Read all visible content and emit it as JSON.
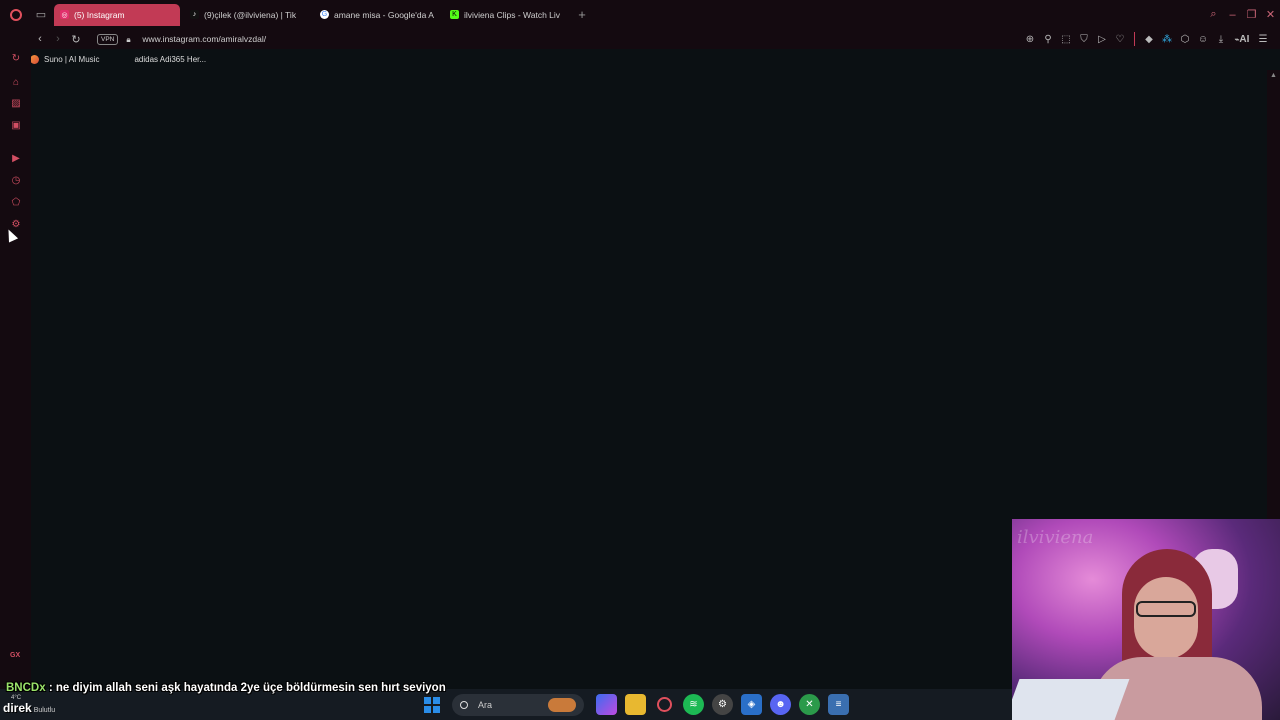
{
  "browser": {
    "tabs": [
      {
        "label": "(5) Instagram",
        "icon": "instagram-icon",
        "color": "#e1306c",
        "active": true
      },
      {
        "label": "(9)çilek (@ilviviena) | Tik",
        "icon": "tiktok-icon",
        "color": "#111111",
        "active": false
      },
      {
        "label": "amane misa - Google'da A",
        "icon": "google-icon",
        "color": "#4285f4",
        "active": false
      },
      {
        "label": "ilviviena Clips - Watch Liv",
        "icon": "kick-icon",
        "color": "#53fc18",
        "active": false
      }
    ],
    "vpn_label": "VPN",
    "url": "www.instagram.com/amiralvzdal/",
    "ai_label": "AI",
    "accent": "#c23a55"
  },
  "bookmarks": [
    {
      "label": "Suno | AI Music"
    },
    {
      "label": "adidas Adi365 Her..."
    }
  ],
  "sidebar": {
    "gx_label": "GX",
    "accent": "#d24f63"
  },
  "chat": {
    "user": "BNCDx",
    "separator": " : ",
    "message": "ne diyim allah seni aşk hayatında 2ye üçe böldürmesin sen hırt seviyon"
  },
  "taskbar": {
    "weather_main": "direk",
    "weather_sub": "Bulutlu",
    "weather_temp": "4°C",
    "search_placeholder": "Ara"
  },
  "webcam": {
    "watermark": "ilviviena"
  }
}
